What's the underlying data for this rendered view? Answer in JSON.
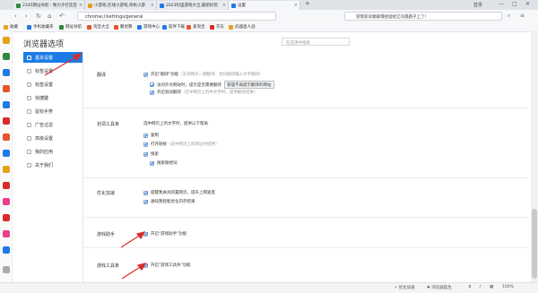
{
  "tabs": [
    {
      "label": "2345网址导航 - 致力于打造百",
      "active": false,
      "color": "#2c8b3e"
    },
    {
      "label": "小游戏,在线小游戏,单机小游",
      "active": false,
      "color": "#e4a21b"
    },
    {
      "label": "2023阿里游戏大全,最新好玩",
      "active": false,
      "color": "#1e7be6"
    },
    {
      "label": "设置",
      "active": true,
      "color": "#1e7be6"
    }
  ],
  "tab_add": "+",
  "login_text": "登录",
  "window_controls": [
    "—",
    "□",
    "✕"
  ],
  "address": {
    "url": "chrome://settings/general"
  },
  "search_bar": {
    "text": "游客胶诉踢解惧相谐扰辽问遇题子上了！"
  },
  "bookmarks": [
    {
      "label": "收藏",
      "color": "#e4a21b"
    },
    {
      "label": "手机收藏夹",
      "color": "#1e7be6"
    },
    {
      "label": "网址导航",
      "color": "#2c8b3e"
    },
    {
      "label": "淘宝大全",
      "color": "#e6542c"
    },
    {
      "label": "聚划算",
      "color": "#e6542c"
    },
    {
      "label": "游戏中心",
      "color": "#1e7be6"
    },
    {
      "label": "软件下载",
      "color": "#1e7be6"
    },
    {
      "label": "爱淘宝",
      "color": "#e6542c"
    },
    {
      "label": "京东",
      "color": "#d92b2b"
    },
    {
      "label": "武器迷人战",
      "color": "#e4a21b"
    }
  ],
  "settings": {
    "title": "浏览器选项",
    "search_placeholder": "在选项中搜索",
    "nav": [
      {
        "label": "基本设置",
        "active": true
      },
      {
        "label": "标签设置",
        "active": false
      },
      {
        "label": "标签设置",
        "active": false
      },
      {
        "label": "快捷键",
        "active": false
      },
      {
        "label": "鼠标手势",
        "active": false
      },
      {
        "label": "广告过滤",
        "active": false
      },
      {
        "label": "高级设置",
        "active": false
      },
      {
        "label": "我的应用",
        "active": false
      },
      {
        "label": "关于我们",
        "active": false
      }
    ],
    "sections": {
      "translate": {
        "heading": "翻译",
        "main_label": "开启\"翻译\"功能",
        "main_hint": "（支持网页一键翻译、划词翻译输入文字翻译）",
        "sub1_label": "访问外文网站时，提示是否需要翻译",
        "sub1_button": "管理不再提示翻译的网站",
        "sub2_label": "开启划词翻译",
        "sub2_hint": "（在中网页上的中文字时，提供翻译结果）"
      },
      "word": {
        "heading": "划词工具条",
        "desc": "选中网页上的文字时，提供以下帮助",
        "copy": "复制",
        "open_url": "打开链接",
        "open_url_hint": "（选中网页上的网址时提供）",
        "search": "搜索",
        "search_sub": "搜索联想词"
      },
      "optimize": {
        "heading": "优化加速",
        "opt1": "提醒我关闭闲置网页，提升上网速度",
        "opt2": "通知我智能优化内存结果"
      },
      "game": {
        "heading": "游戏助手",
        "label": "开启\"游戏助手\"功能"
      },
      "gametool": {
        "heading": "游戏工具条",
        "label": "开启\"游戏工具条\"功能"
      }
    }
  },
  "status_bar": {
    "optimize": "优化加速",
    "repair": "浏览器医生",
    "zoom": "100%"
  },
  "colors": {
    "accent": "#1e7be6",
    "arrow": "#d92b2b"
  }
}
